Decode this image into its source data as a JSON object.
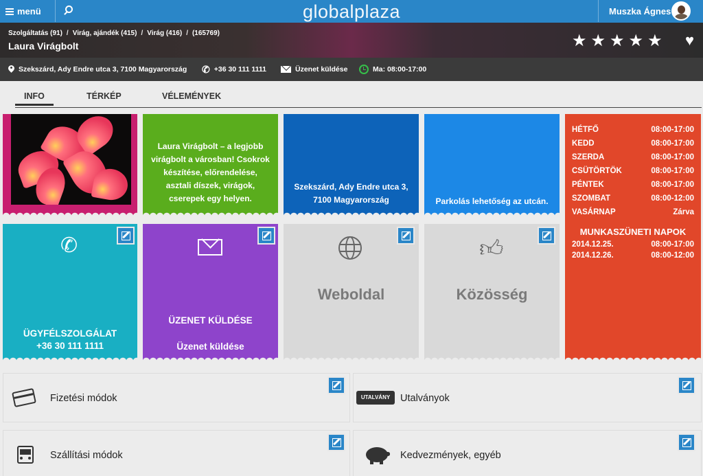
{
  "topbar": {
    "menu_label": "menü",
    "logo": "globalplaza",
    "user_name": "Muszka Ágnes"
  },
  "hero": {
    "breadcrumb": [
      "Szolgáltatás (91)",
      "Virág, ajándék (415)",
      "Virág (416)",
      "(165769)"
    ],
    "business_name": "Laura Virágbolt",
    "rating": 5
  },
  "infobar": {
    "address": "Szekszárd, Ady Endre utca 3, 7100 Magyarország",
    "phone": "+36 30 111 1111",
    "message": "Üzenet küldése",
    "hours_today": "Ma: 08:00-17:00"
  },
  "tabs": [
    {
      "label": "INFO",
      "active": true
    },
    {
      "label": "TÉRKÉP",
      "active": false
    },
    {
      "label": "VÉLEMÉNYEK",
      "active": false
    }
  ],
  "tiles": {
    "description": "Laura Virágbolt – a legjobb virágbolt a városban! Csokrok készítése, előrendelése, asztali díszek, virágok, cserepek egy helyen.",
    "address": "Szekszárd, Ady Endre utca 3, 7100 Magyarország",
    "parking": "Parkolás lehetőség az utcán.",
    "customer_service_title": "ÜGYFÉLSZOLGÁLAT",
    "customer_service_phone": "+36 30 111 1111",
    "message_title": "ÜZENET KÜLDÉSE",
    "message_sub": "Üzenet küldése",
    "website": "Weboldal",
    "community": "Közösség"
  },
  "hours": {
    "days": [
      {
        "day": "HÉTFŐ",
        "time": "08:00-17:00"
      },
      {
        "day": "KEDD",
        "time": "08:00-17:00"
      },
      {
        "day": "SZERDA",
        "time": "08:00-17:00"
      },
      {
        "day": "CSÜTÖRTÖK",
        "time": "08:00-17:00"
      },
      {
        "day": "PÉNTEK",
        "time": "08:00-17:00"
      },
      {
        "day": "SZOMBAT",
        "time": "08:00-12:00"
      },
      {
        "day": "VASÁRNAP",
        "time": "Zárva"
      }
    ],
    "holiday_title": "MUNKASZÜNETI NAPOK",
    "holidays": [
      {
        "date": "2014.12.25.",
        "time": "08:00-17:00"
      },
      {
        "date": "2014.12.26.",
        "time": "08:00-12:00"
      }
    ]
  },
  "bottom": {
    "payment": "Fizetési módok",
    "vouchers": "Utalványok",
    "voucher_icon_text": "UTALVÁNY",
    "shipping": "Szállítási módok",
    "discounts": "Kedvezmények, egyéb"
  },
  "colors": {
    "header_blue": "#2a86c8",
    "green": "#5aad1d",
    "dark_blue": "#0d63b9",
    "light_blue": "#1c88e6",
    "teal": "#19afc3",
    "purple": "#8e44cb",
    "gray_tile": "#d9d9d9",
    "orange": "#e1472a",
    "magenta": "#c81f6f"
  }
}
